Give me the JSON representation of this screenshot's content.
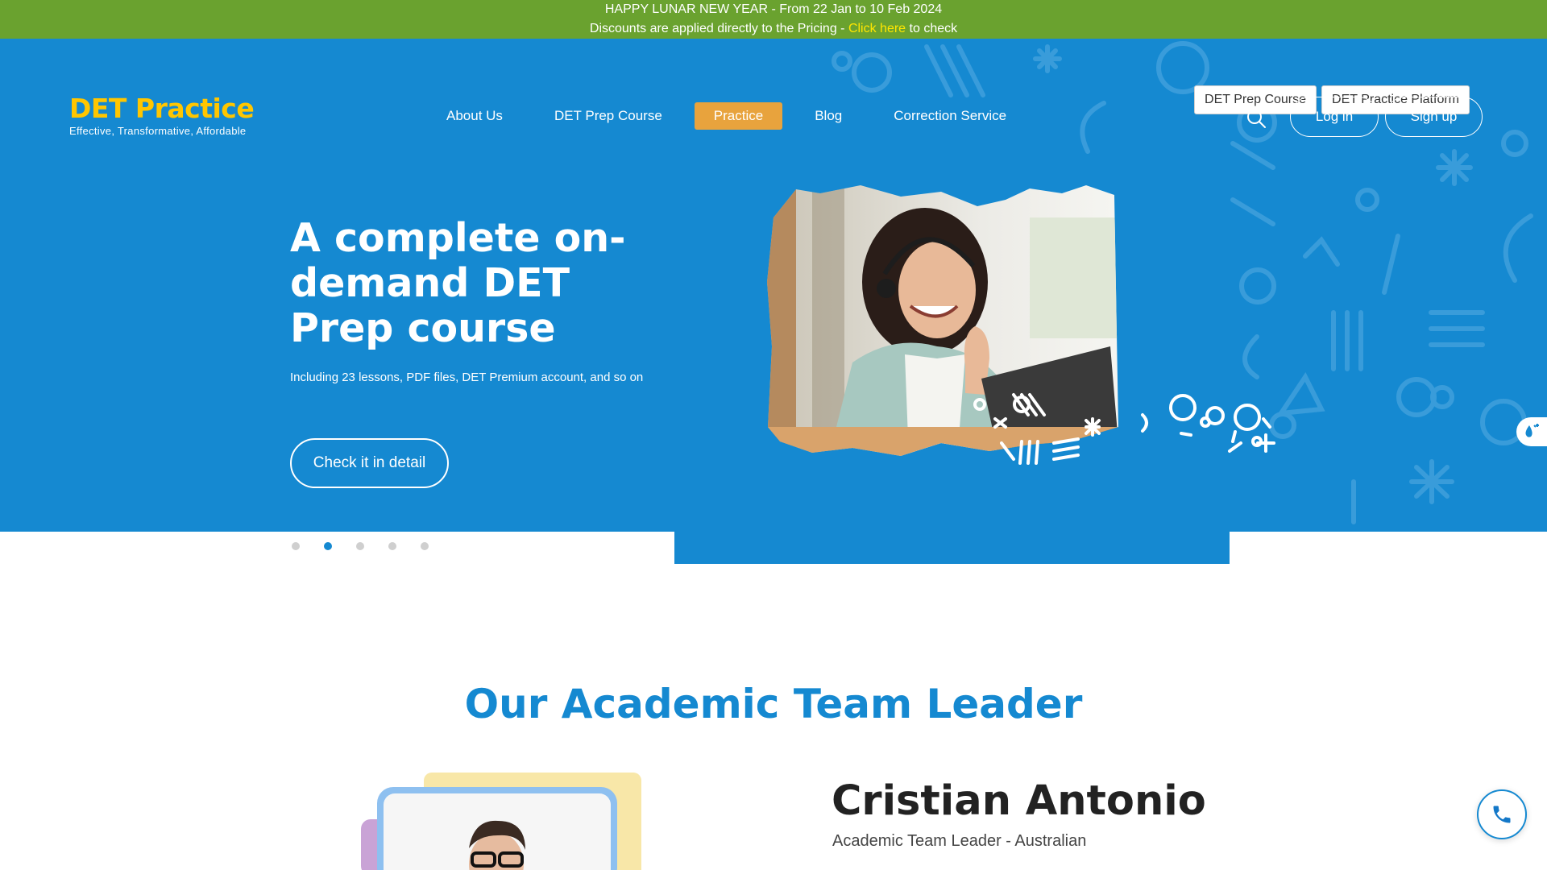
{
  "promo": {
    "line1": "HAPPY LUNAR NEW YEAR - From 22 Jan to 10 Feb 2024",
    "line2_before": "Discounts are applied directly to the Pricing - ",
    "line2_link": "Click here",
    "line2_after": " to check"
  },
  "top_links": [
    "DET Prep Course",
    "DET Practice Platform"
  ],
  "logo": {
    "name": "DET Practice",
    "tagline": "Effective, Transformative, Affordable"
  },
  "nav": {
    "items": [
      "About Us",
      "DET Prep Course",
      "Practice",
      "Blog",
      "Correction Service"
    ],
    "active": "Practice"
  },
  "auth": {
    "login": "Log in",
    "signup": "Sign up"
  },
  "hero": {
    "title": "A complete on-demand DET Prep course",
    "subtitle": "Including 23 lessons, PDF files, DET Premium account, and so on",
    "cta": "Check it in detail"
  },
  "slider": {
    "count": 5,
    "active_index": 1
  },
  "section": {
    "title": "Our Academic Team Leader"
  },
  "person": {
    "name": "Cristian Antonio",
    "role": "Academic Team Leader - Australian"
  },
  "colors": {
    "brand_blue": "#1589d1",
    "promo_green": "#6aa22f",
    "accent_yellow": "#ffc600",
    "active_orange": "#e8a33d"
  },
  "icons": [
    "search-icon",
    "phone-icon",
    "side-widget-icon"
  ]
}
